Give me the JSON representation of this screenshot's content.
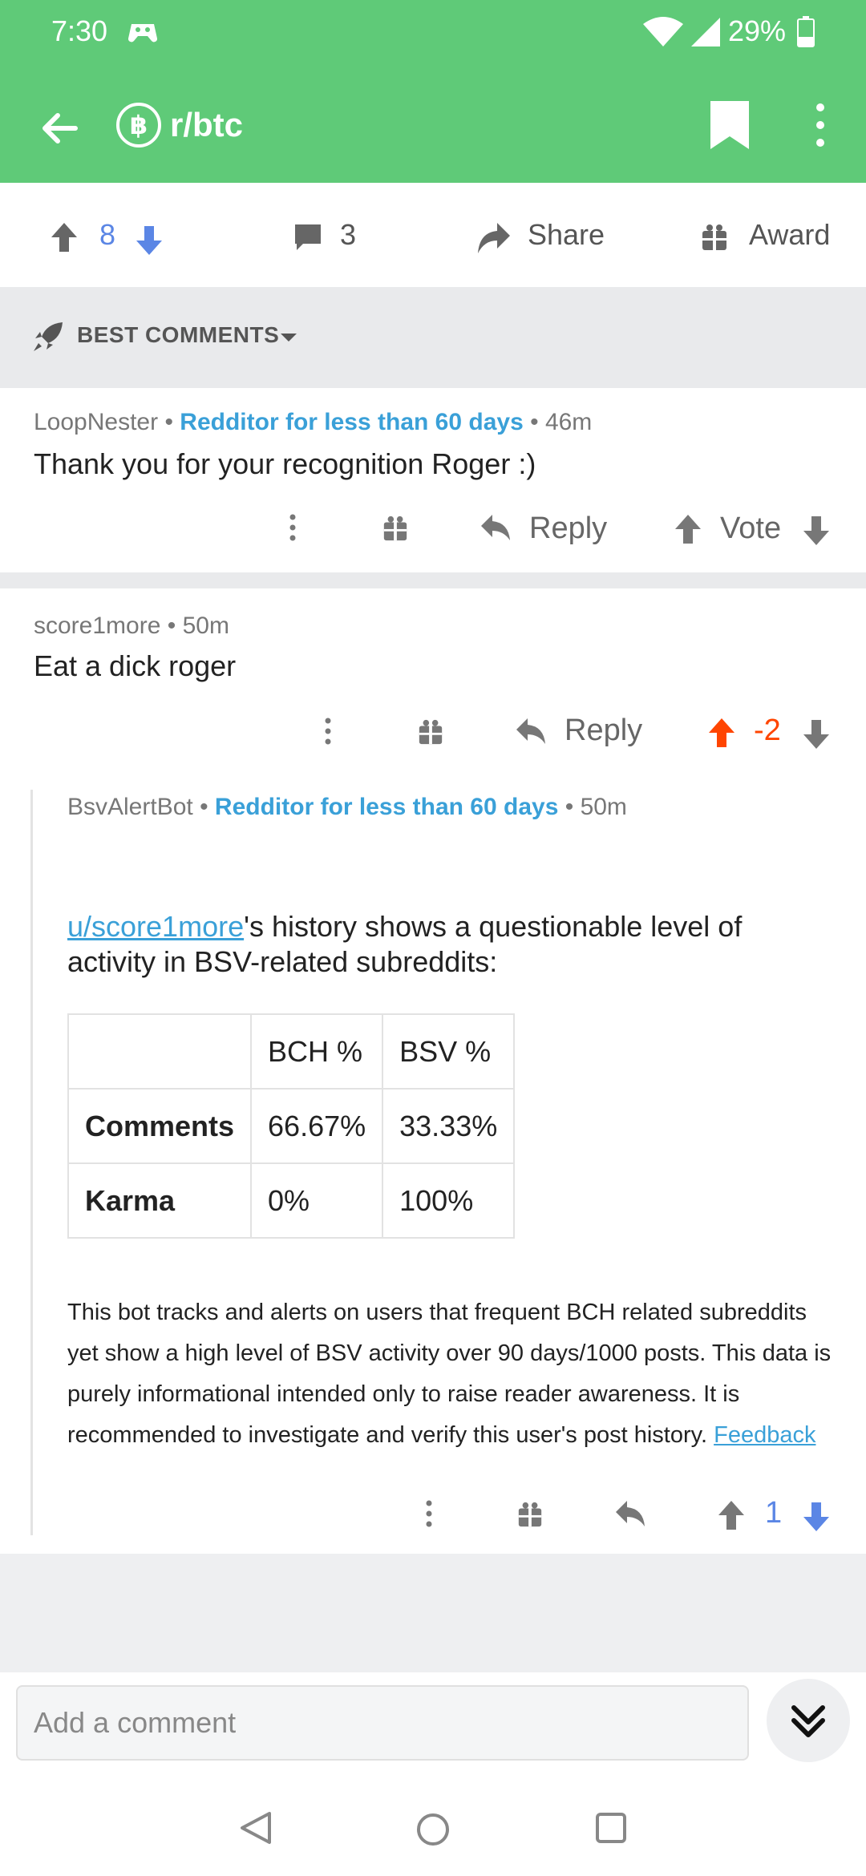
{
  "status": {
    "time": "7:30",
    "battery": "29%"
  },
  "toolbar": {
    "subreddit": "r/btc",
    "sub_icon_glyph": "฿"
  },
  "post_actions": {
    "score": "8",
    "comments": "3",
    "share": "Share",
    "award": "Award"
  },
  "sort": {
    "label": "BEST COMMENTS"
  },
  "comments": [
    {
      "author": "LoopNester",
      "flair": "Redditor for less than 60 days",
      "age": "46m",
      "body": "Thank you for your recognition Roger :)",
      "reply": "Reply",
      "vote": "Vote"
    },
    {
      "author": "score1more",
      "age": "50m",
      "body": "Eat a dick roger",
      "reply": "Reply",
      "score": "-2",
      "upvoted": true
    },
    {
      "author": "BsvAlertBot",
      "flair": "Redditor for less than 60 days",
      "age": "50m",
      "body_link": "u/score1more",
      "body_line1": "'s history shows a questionable level of",
      "body_line2": "activity in BSV-related subreddits:",
      "table": {
        "headers": [
          "",
          "BCH %",
          "BSV %"
        ],
        "rows": [
          [
            "Comments",
            "66.67%",
            "33.33%"
          ],
          [
            "Karma",
            "0%",
            "100%"
          ]
        ]
      },
      "footnote": "This bot tracks and alerts on users that frequent BCH related subreddits yet show a high level of BSV activity over 90 days/1000 posts. This data is purely informational intended only to raise reader awareness. It is recommended to investigate and verify this user's post history.",
      "feedback": "Feedback",
      "score": "1"
    }
  ],
  "composer": {
    "placeholder": "Add a comment"
  },
  "colors": {
    "header": "#5fca78",
    "upvote": "#ff4500",
    "downvote": "#5b86e5",
    "flair": "#3aa0d8"
  }
}
